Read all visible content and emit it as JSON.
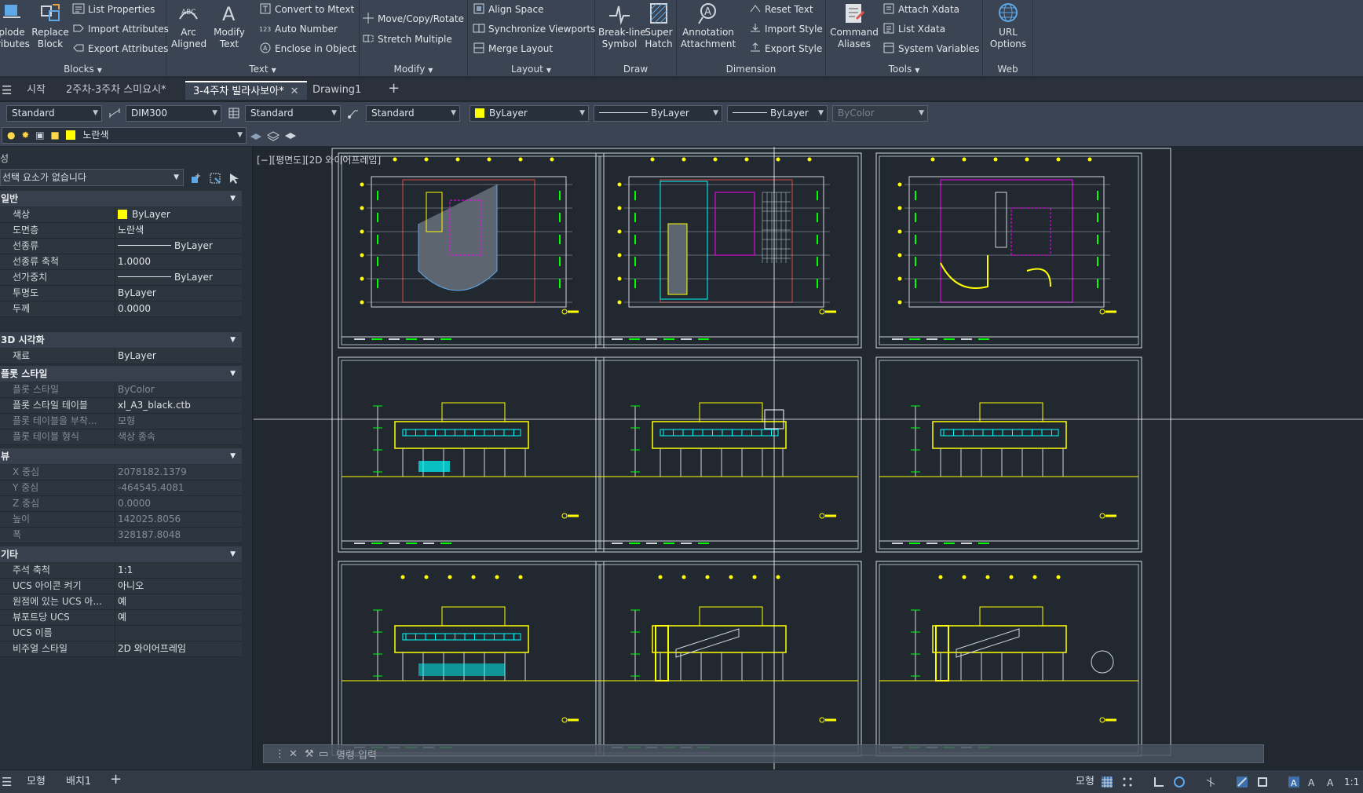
{
  "ribbon": {
    "blocks": {
      "title": "Blocks",
      "explode": "plode\nributes",
      "replace": "Replace\nBlock",
      "list_props": "List Properties",
      "import_attr": "Import Attributes",
      "export_attr": "Export Attributes"
    },
    "text": {
      "title": "Text",
      "arc_aligned": "Arc\nAligned",
      "modify_text": "Modify\nText",
      "convert_mtext": "Convert to Mtext",
      "auto_number": "Auto Number",
      "enclose": "Enclose in Object"
    },
    "modify": {
      "title": "Modify",
      "move_copy": "Move/Copy/Rotate",
      "stretch_multiple": "Stretch Multiple"
    },
    "layout": {
      "title": "Layout",
      "align_space": "Align Space",
      "sync_viewports": "Synchronize Viewports",
      "merge_layout": "Merge Layout"
    },
    "draw": {
      "title": "Draw",
      "breakline": "Break-line\nSymbol",
      "super_hatch": "Super\nHatch"
    },
    "dimension": {
      "title": "Dimension",
      "annotation": "Annotation\nAttachment",
      "reset_text": "Reset Text",
      "import_style": "Import Style",
      "export_style": "Export Style"
    },
    "tools": {
      "title": "Tools",
      "command_aliases": "Command\nAliases",
      "attach_xdata": "Attach Xdata",
      "list_xdata": "List Xdata",
      "system_vars": "System Variables"
    },
    "web": {
      "title": "Web",
      "url_options": "URL\nOptions"
    }
  },
  "doc_tabs": [
    "시작",
    "2주차-3주차 스미요시*",
    "3-4주차 빌라사보아*",
    "Drawing1"
  ],
  "active_tab_index": 2,
  "propbar": {
    "text_style": "Standard",
    "dim_style": "DIM300",
    "table_style": "Standard",
    "mleader_style": "Standard",
    "color": "ByLayer",
    "linetype": "ByLayer",
    "lineweight": "ByLayer",
    "plotstyle": "ByColor",
    "layer": "노란색"
  },
  "properties": {
    "title": "성",
    "selection": "선택 요소가 없습니다",
    "cat_general": "일반",
    "general": [
      {
        "k": "색상",
        "v": "ByLayer",
        "swatch": true
      },
      {
        "k": "도면층",
        "v": "노란색"
      },
      {
        "k": "선종류",
        "v": "ByLayer",
        "line": true
      },
      {
        "k": "선종류 축척",
        "v": "1.0000"
      },
      {
        "k": "선가중치",
        "v": "ByLayer",
        "line": true
      },
      {
        "k": "투명도",
        "v": "ByLayer"
      },
      {
        "k": "두께",
        "v": "0.0000"
      }
    ],
    "cat_3d": "3D 시각화",
    "viz3d": [
      {
        "k": "재료",
        "v": "ByLayer"
      }
    ],
    "cat_plot": "플롯 스타일",
    "plot": [
      {
        "k": "플롯 스타일",
        "v": "ByColor",
        "dim": true
      },
      {
        "k": "플롯 스타일 테이블",
        "v": "xl_A3_black.ctb"
      },
      {
        "k": "플롯 테이블을 부착...",
        "v": "모형",
        "dim": true
      },
      {
        "k": "플롯 테이블 형식",
        "v": "색상 종속",
        "dim": true
      }
    ],
    "cat_view": "뷰",
    "view": [
      {
        "k": "X 중심",
        "v": "2078182.1379",
        "dim": true
      },
      {
        "k": "Y 중심",
        "v": "-464545.4081",
        "dim": true
      },
      {
        "k": "Z 중심",
        "v": "0.0000",
        "dim": true
      },
      {
        "k": "높이",
        "v": "142025.8056",
        "dim": true
      },
      {
        "k": "폭",
        "v": "328187.8048",
        "dim": true
      }
    ],
    "cat_misc": "기타",
    "misc": [
      {
        "k": "주석 축척",
        "v": "1:1"
      },
      {
        "k": "UCS 아이콘 켜기",
        "v": "아니오"
      },
      {
        "k": "원점에 있는 UCS 아...",
        "v": "예"
      },
      {
        "k": "뷰포트당 UCS",
        "v": "예"
      },
      {
        "k": "UCS 이름",
        "v": ""
      },
      {
        "k": "비주얼 스타일",
        "v": "2D 와이어프레임"
      }
    ]
  },
  "viewport_label": "[−][평면도][2D 와이어프레임]",
  "command_placeholder": "명령 입력",
  "layout_tabs": [
    "모형",
    "배치1"
  ],
  "status": {
    "model": "모형",
    "scale": "1:1"
  },
  "colors": {
    "accent_yellow": "#ffff00",
    "cyan": "#00ffff",
    "magenta": "#ff00ff",
    "green": "#00ff00",
    "canvas_bg": "#212830"
  }
}
